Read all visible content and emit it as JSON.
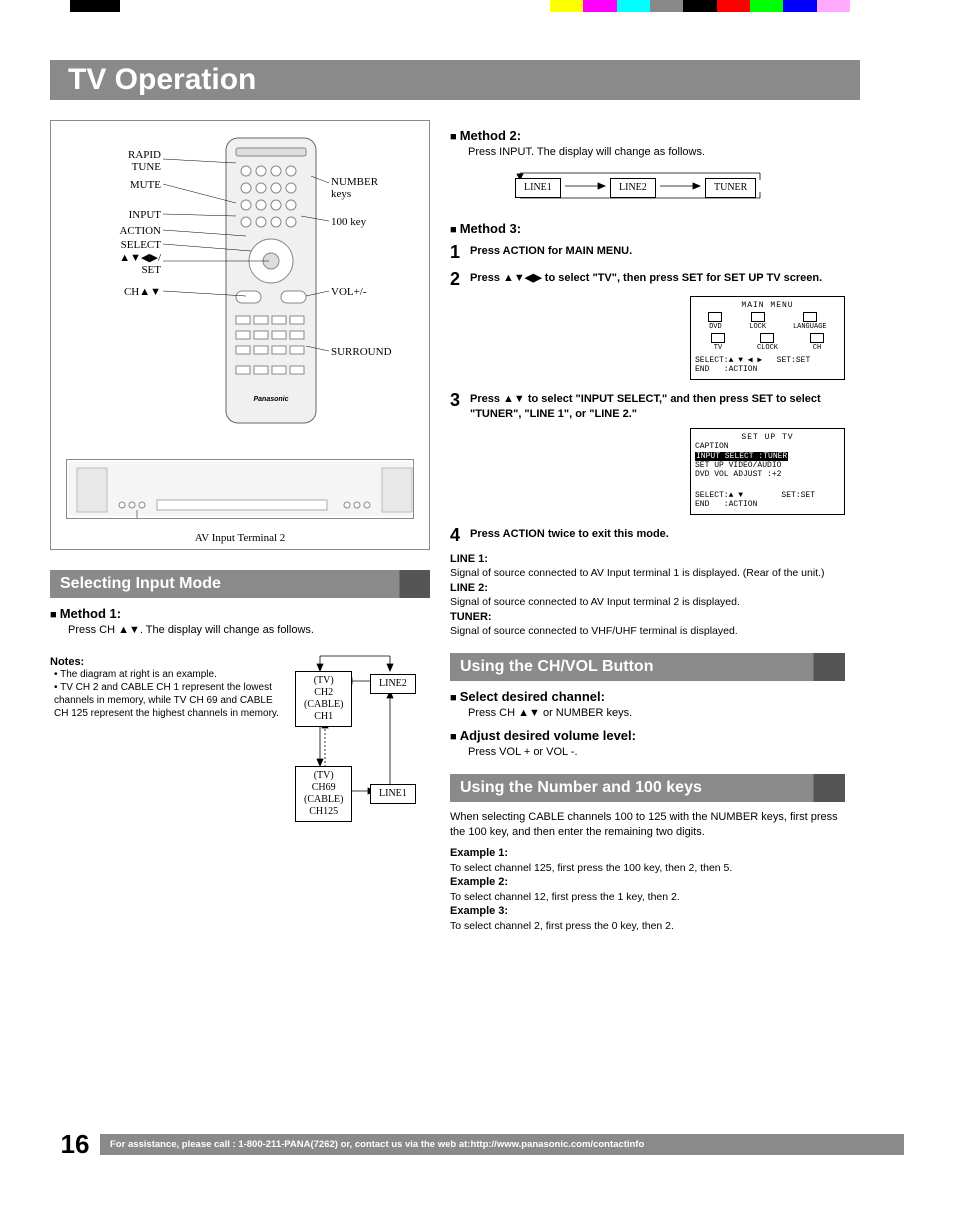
{
  "title": "TV Operation",
  "remote": {
    "labels": {
      "rapid_tune": "RAPID\nTUNE",
      "mute": "MUTE",
      "input": "INPUT",
      "action": "ACTION",
      "select": "SELECT",
      "arrows_set": "▲▼◀▶/\nSET",
      "ch": "CH▲▼",
      "number_keys": "NUMBER\nkeys",
      "key100": "100 key",
      "vol": "VOL+/-",
      "surround": "SURROUND"
    },
    "av_terminal": "AV Input Terminal 2"
  },
  "section1": {
    "title": "Selecting Input Mode",
    "method1": "Method 1:",
    "method1_text": "Press CH ▲▼. The display will change as follows.",
    "notes_title": "Notes:",
    "notes": [
      "The diagram at right is an example.",
      "TV CH 2 and CABLE CH 1 represent the lowest channels in memory, while TV CH 69 and CABLE CH 125 represent the highest channels in memory."
    ],
    "flow": {
      "box1": "(TV)\nCH2\n(CABLE)\nCH1",
      "box2": "(TV)\nCH69\n(CABLE)\nCH125",
      "line1": "LINE1",
      "line2": "LINE2"
    }
  },
  "method2": {
    "title": "Method 2:",
    "text": "Press INPUT. The display will change as follows.",
    "flow": {
      "line1": "LINE1",
      "line2": "LINE2",
      "tuner": "TUNER"
    }
  },
  "method3": {
    "title": "Method 3:",
    "steps": [
      {
        "n": "1",
        "text": "Press ACTION for MAIN MENU."
      },
      {
        "n": "2",
        "text": "Press ▲▼◀▶ to select \"TV\", then press SET for SET UP TV screen."
      },
      {
        "n": "3",
        "text": "Press ▲▼ to select \"INPUT SELECT,\" and then press SET to select \"TUNER\", \"LINE 1\", or \"LINE 2.\""
      },
      {
        "n": "4",
        "text": "Press ACTION twice to exit this mode."
      }
    ],
    "osd1": {
      "title": "MAIN MENU",
      "row1": [
        "DVD",
        "LOCK",
        "LANGUAGE"
      ],
      "row2": [
        "TV",
        "CLOCK",
        "CH"
      ],
      "footer": "SELECT:▲ ▼ ◀ ▶   SET:SET\nEND   :ACTION"
    },
    "osd2": {
      "title": "SET UP TV",
      "lines": [
        "CAPTION",
        "INPUT SELECT   :TUNER",
        "SET UP VIDEO/AUDIO",
        "DVD VOL ADJUST :+2"
      ],
      "footer": "SELECT:▲ ▼        SET:SET\nEND   :ACTION"
    },
    "defs": {
      "line1_t": "LINE 1:",
      "line1": "Signal of source connected to AV Input terminal 1 is displayed. (Rear of the unit.)",
      "line2_t": "LINE 2:",
      "line2": "Signal of source connected to AV Input terminal 2 is displayed.",
      "tuner_t": "TUNER:",
      "tuner": "Signal of source connected to VHF/UHF terminal is displayed."
    }
  },
  "section2": {
    "title": "Using the CH/VOL Button",
    "sel_title": "Select desired channel:",
    "sel_text": "Press CH ▲▼ or NUMBER keys.",
    "vol_title": "Adjust desired volume level:",
    "vol_text": "Press VOL + or VOL -."
  },
  "section3": {
    "title": "Using the Number and 100 keys",
    "intro": "When selecting CABLE channels 100 to 125 with the NUMBER keys, first press the 100 key, and then enter the remaining two digits.",
    "ex1_t": "Example 1:",
    "ex1": "To select channel 125, first press the 100 key, then 2, then 5.",
    "ex2_t": "Example 2:",
    "ex2": "To select channel 12, first press the 1 key, then 2.",
    "ex3_t": "Example 3:",
    "ex3": "To select channel 2, first press the 0 key, then 2."
  },
  "footer": {
    "page": "16",
    "text": "For assistance, please call : 1-800-211-PANA(7262) or, contact us via the web at:http://www.panasonic.com/contactinfo"
  }
}
